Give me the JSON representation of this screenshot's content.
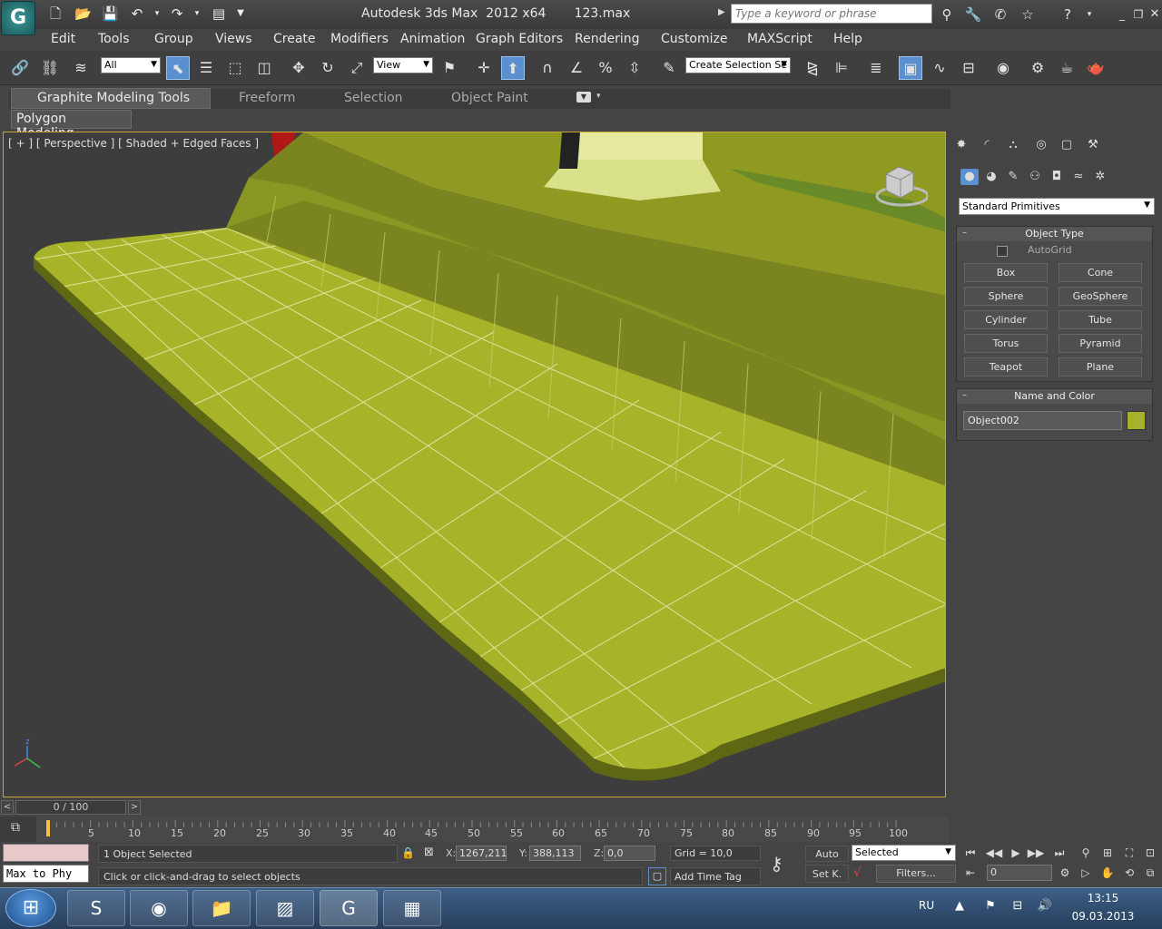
{
  "titlebar": {
    "title": "Autodesk 3ds Max  2012 x64       123.max",
    "search_placeholder": "Type a keyword or phrase",
    "logo_glyph": "G"
  },
  "menu": [
    "Edit",
    "Tools",
    "Group",
    "Views",
    "Create",
    "Modifiers",
    "Animation",
    "Graph Editors",
    "Rendering",
    "Customize",
    "MAXScript",
    "Help"
  ],
  "toolbar": {
    "selection_filter": "All",
    "reference_coord": "View",
    "named_selection": "Create Selection Se"
  },
  "ribbon": {
    "tabs": [
      "Graphite Modeling Tools",
      "Freeform",
      "Selection",
      "Object Paint"
    ],
    "panel": "Polygon Modeling"
  },
  "viewport": {
    "label": "[ + ] [ Perspective ] [ Shaded + Edged Faces ]",
    "mesh_color": "#a7b42a",
    "border_color": "#c9a43a"
  },
  "command_panel": {
    "category": "Standard Primitives",
    "object_type_title": "Object Type",
    "autogrid_label": "AutoGrid",
    "primitives": [
      "Box",
      "Cone",
      "Sphere",
      "GeoSphere",
      "Cylinder",
      "Tube",
      "Torus",
      "Pyramid",
      "Teapot",
      "Plane"
    ],
    "name_color_title": "Name and Color",
    "object_name": "Object002",
    "object_color": "#a6b22c"
  },
  "timeline": {
    "frame_display": "0 / 100",
    "ticks": [
      "5",
      "10",
      "15",
      "20",
      "25",
      "30",
      "35",
      "40",
      "45",
      "50",
      "55",
      "60",
      "65",
      "70",
      "75",
      "80",
      "85",
      "90",
      "95",
      "100"
    ]
  },
  "status": {
    "maxscript_text": "Max to Phy",
    "selection_info": "1 Object Selected",
    "prompt": "Click or click-and-drag to select objects",
    "x_label": "X:",
    "x_value": "1267,211",
    "y_label": "Y:",
    "y_value": "388,113",
    "z_label": "Z:",
    "z_value": "0,0",
    "grid": "Grid = 10,0",
    "add_time_tag": "Add Time Tag",
    "auto_key": "Auto",
    "set_key": "Set K.",
    "key_filter": "Selected",
    "filters": "Filters...",
    "current_frame": "0"
  },
  "taskbar": {
    "lang": "RU",
    "time": "13:15",
    "date": "09.03.2013"
  }
}
